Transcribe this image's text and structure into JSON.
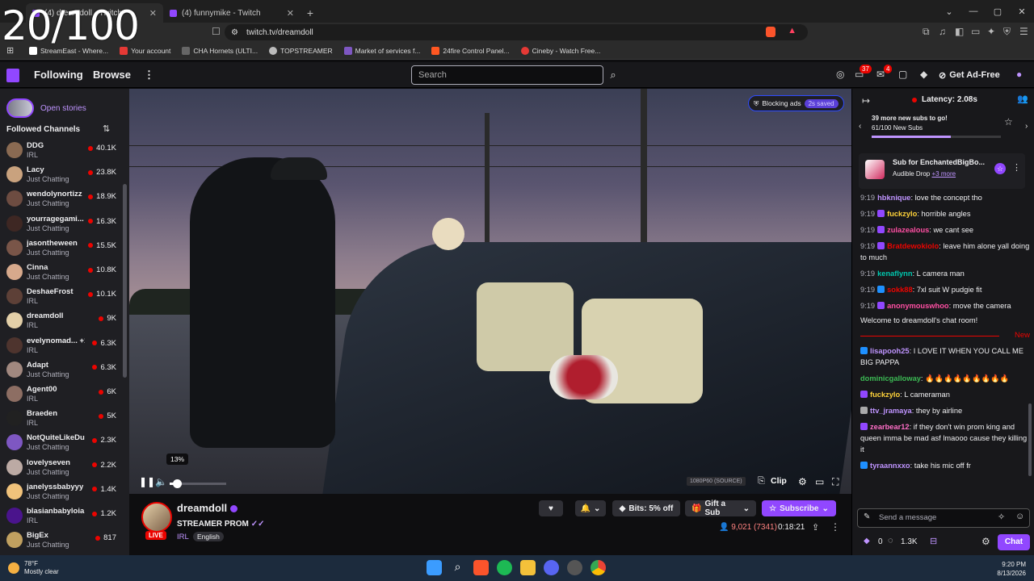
{
  "overlay_counter": "20/100",
  "browser": {
    "tabs": [
      {
        "label": "(4) dreamdoll - Twitch",
        "active": true
      },
      {
        "label": "(4) funnymike - Twitch",
        "active": false
      }
    ],
    "url": "twitch.tv/dreamdoll",
    "bookmarks": [
      {
        "label": "StreamEast - Where...",
        "color": "#ffffff"
      },
      {
        "label": "Your account",
        "color": "#e53935"
      },
      {
        "label": "CHA Hornets (ULTI...",
        "color": "#666666"
      },
      {
        "label": "TOPSTREAMER",
        "color": "#bbbbbb"
      },
      {
        "label": "Market of services f...",
        "color": "#7e57c2"
      },
      {
        "label": "24fire Control Panel...",
        "color": "#ff5722"
      },
      {
        "label": "Cineby - Watch Free...",
        "color": "#e53935"
      }
    ]
  },
  "twitch_nav": {
    "following": "Following",
    "browse": "Browse",
    "search_placeholder": "Search",
    "badge_1": "37",
    "badge_2": "4",
    "get_ad_free": "Get Ad-Free"
  },
  "sidebar": {
    "open_stories": "Open stories",
    "followed_channels": "Followed Channels",
    "channels": [
      {
        "name": "DDG",
        "category": "IRL",
        "viewers": "40.1K",
        "color": "#8a6a52"
      },
      {
        "name": "Lacy",
        "category": "Just Chatting",
        "viewers": "23.8K",
        "color": "#c9a27e"
      },
      {
        "name": "wendolynortizz",
        "category": "Just Chatting",
        "viewers": "18.9K",
        "color": "#6d4c41"
      },
      {
        "name": "yourragegami...",
        "category": "Just Chatting",
        "viewers": "16.3K",
        "color": "#3e2723"
      },
      {
        "name": "jasontheween",
        "category": "Just Chatting",
        "viewers": "15.5K",
        "color": "#795548"
      },
      {
        "name": "Cinna",
        "category": "Just Chatting",
        "viewers": "10.8K",
        "color": "#d7a98c"
      },
      {
        "name": "DeshaeFrost",
        "category": "IRL",
        "viewers": "10.1K",
        "color": "#5d4037"
      },
      {
        "name": "dreamdoll",
        "category": "IRL",
        "viewers": "9K",
        "color": "#e3cfa8"
      },
      {
        "name": "evelynomad... +1",
        "category": "IRL",
        "viewers": "6.3K",
        "color": "#4e342e"
      },
      {
        "name": "Adapt",
        "category": "Just Chatting",
        "viewers": "6.3K",
        "color": "#a1887f"
      },
      {
        "name": "Agent00",
        "category": "IRL",
        "viewers": "6K",
        "color": "#8d6e63"
      },
      {
        "name": "Braeden",
        "category": "IRL",
        "viewers": "5K",
        "color": "#212121"
      },
      {
        "name": "NotQuiteLikeDuB",
        "category": "Just Chatting",
        "viewers": "2.3K",
        "color": "#7e57c2"
      },
      {
        "name": "lovelyseven",
        "category": "Just Chatting",
        "viewers": "2.2K",
        "color": "#bcaaa4"
      },
      {
        "name": "janelyssbabyyy",
        "category": "Just Chatting",
        "viewers": "1.4K",
        "color": "#f0c27b"
      },
      {
        "name": "blasianbabyloia",
        "category": "IRL",
        "viewers": "1.2K",
        "color": "#4a148c"
      },
      {
        "name": "BigEx",
        "category": "Just Chatting",
        "viewers": "817",
        "color": "#c0a060"
      }
    ]
  },
  "player": {
    "blocking_ads": "Blocking ads",
    "saved": "2s saved",
    "volume_tooltip": "13%",
    "volume_level": 0.13,
    "quality": "1080P60 (SOURCE)",
    "clip": "Clip"
  },
  "stream": {
    "streamer": "dreamdoll",
    "live": "LIVE",
    "title": "STREAMER PROM",
    "category": "IRL",
    "tag": "English",
    "bits": "Bits: 5% off",
    "gift": "Gift a Sub",
    "subscribe": "Subscribe",
    "viewers": "9,021 (7341)",
    "uptime": "0:18:21"
  },
  "chat": {
    "latency": "Latency: 2.08s",
    "goal_line1": "39 more new subs to go!",
    "goal_line2": "61/100 New Subs",
    "goal_progress": 0.61,
    "pinned_title": "Sub for EnchantedBigBo...",
    "pinned_sub": "Audible Drop",
    "pinned_more": "+3 more",
    "messages": [
      {
        "time": "9:19",
        "user": "hbknique",
        "text": ": love the concept tho",
        "color": "#bf94ff",
        "badge": ""
      },
      {
        "time": "9:19",
        "user": "fuckzylo",
        "text": ": horrible angles",
        "color": "#ffd33a",
        "badge": "#9147ff"
      },
      {
        "time": "9:19",
        "user": "zulazealous",
        "text": ": we cant see",
        "color": "#ff4fa3",
        "badge": "#9147ff"
      },
      {
        "time": "9:19",
        "user": "Bratdewokiolo",
        "text": ": leave him alone yall doing to much",
        "color": "#eb0400",
        "badge": "#9147ff"
      },
      {
        "time": "9:19",
        "user": "kenaflynn",
        "text": ": L camera man",
        "color": "#00c8af",
        "badge": ""
      },
      {
        "time": "9:19",
        "user": "sokk88",
        "text": ": 7xl suit W pudgie fit",
        "color": "#eb0400",
        "badge": "#1e90ff"
      },
      {
        "time": "9:19",
        "user": "anonymouswhoo",
        "text": ": move the camera",
        "color": "#ff4fa3",
        "badge": "#9147ff"
      }
    ],
    "welcome": "Welcome to dreamdoll's chat room!",
    "new_label": "New",
    "new_messages": [
      {
        "user": "lisapooh25",
        "text": ": I LOVE IT WHEN YOU CALL ME BIG PAPPA",
        "color": "#bf94ff",
        "badge": "#1e90ff"
      },
      {
        "user": "dominicgalloway",
        "text": ": 🔥🔥🔥🔥🔥🔥🔥🔥🔥",
        "color": "#3cba54",
        "badge": ""
      },
      {
        "user": "fuckzylo",
        "text": ": L cameraman",
        "color": "#ffd33a",
        "badge": "#9147ff"
      },
      {
        "user": "ttv_jramaya",
        "text": ": they by airline",
        "color": "#bf94ff",
        "badge": "#aaaaaa"
      },
      {
        "user": "zearbear12",
        "text": ": if they don't win prom king and queen imma be mad asf lmaooo cause they killing it",
        "color": "#ff6ec7",
        "badge": "#9147ff"
      },
      {
        "user": "tyraannxxo",
        "text": ": take his mic off fr",
        "color": "#bf94ff",
        "badge": "#1e90ff"
      }
    ],
    "input_placeholder": "Send a message",
    "points_left": "0",
    "points_right": "1.3K",
    "chat_button": "Chat"
  },
  "taskbar": {
    "temp": "78°F",
    "condition": "Mostly clear",
    "time": "9:20 PM",
    "date": "8/13/2026"
  }
}
